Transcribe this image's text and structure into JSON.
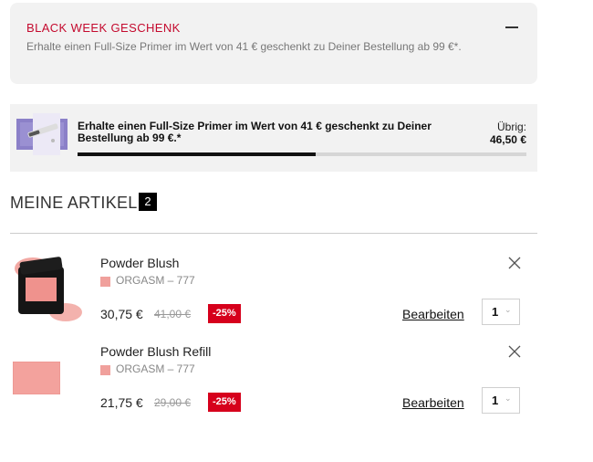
{
  "promo": {
    "title": "BLACK WEEK GESCHENK",
    "text": "Erhalte einen Full-Size Primer im Wert von 41 € geschenkt zu Deiner Bestellung ab 99 €*."
  },
  "gift": {
    "text": "Erhalte einen Full-Size Primer im Wert von 41 € geschenkt zu Deiner Bestellung ab 99 €.*",
    "remaining_label": "Übrig:",
    "remaining_value": "46,50 €",
    "progress_fraction": 0.53
  },
  "cart": {
    "title": "MEINE ARTIKEL",
    "count": "2",
    "items": [
      {
        "name": "Powder Blush",
        "shade": "ORGASM – 777",
        "price": "30,75 €",
        "old_price": "41,00 €",
        "discount": "-25%",
        "edit_label": "Bearbeiten",
        "quantity": "1"
      },
      {
        "name": "Powder Blush Refill",
        "shade": "ORGASM – 777",
        "price": "21,75 €",
        "old_price": "29,00 €",
        "discount": "-25%",
        "edit_label": "Bearbeiten",
        "quantity": "1"
      }
    ]
  },
  "colors": {
    "accent_red": "#c40a2e",
    "discount_red": "#d6001c",
    "shade_swatch": "#f0a09c"
  },
  "icons": {
    "collapse": "minus-icon",
    "remove": "close-icon",
    "chevron": "chevron-down-icon"
  }
}
